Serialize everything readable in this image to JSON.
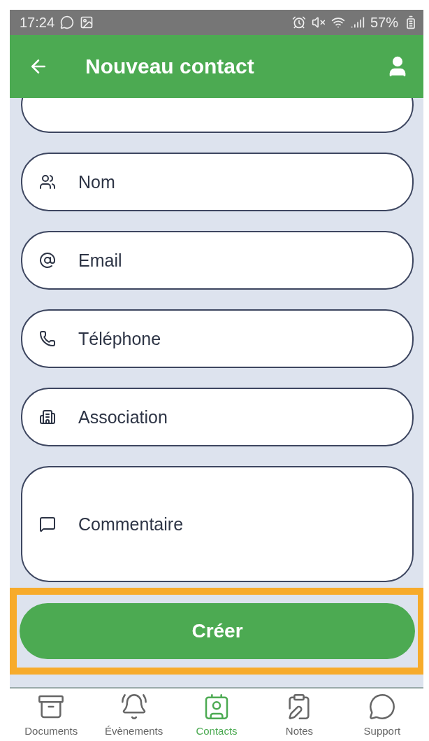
{
  "status_bar": {
    "time": "17:24",
    "battery": "57%"
  },
  "header": {
    "title": "Nouveau contact"
  },
  "fields": [
    {
      "kind": "single",
      "placeholder": "Nom"
    },
    {
      "kind": "single",
      "placeholder": "Email"
    },
    {
      "kind": "single",
      "placeholder": "Téléphone"
    },
    {
      "kind": "single",
      "placeholder": "Association"
    },
    {
      "kind": "multi",
      "placeholder": "Commentaire"
    }
  ],
  "submit_button": {
    "label": "Créer",
    "highlighted": true
  },
  "tabs": [
    {
      "label": "Documents",
      "selected": false
    },
    {
      "label": "Évènements",
      "selected": false
    },
    {
      "label": "Contacts",
      "selected": true
    },
    {
      "label": "Notes",
      "selected": false
    },
    {
      "label": "Support",
      "selected": false
    }
  ]
}
